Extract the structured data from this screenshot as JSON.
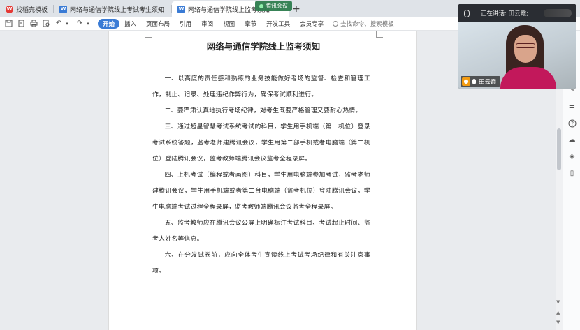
{
  "tabs": [
    {
      "label": "找稻壳模板",
      "icon": "wps-icon",
      "color": "#e53935",
      "active": false
    },
    {
      "label": "网络与通信学院线上考试考生须知",
      "icon": "writer-doc-icon",
      "color": "#3a7bd5",
      "active": false
    },
    {
      "label": "网络与通信学院线上监考须知",
      "icon": "writer-doc-icon",
      "color": "#3a7bd5",
      "active": true
    }
  ],
  "meeting_badge": "腾讯会议",
  "toolbar": {
    "menu": [
      "开始",
      "插入",
      "页面布局",
      "引用",
      "审阅",
      "视图",
      "章节",
      "开发工具",
      "会员专享"
    ],
    "active_menu": "开始",
    "search_placeholder": "查找命令、搜索模板"
  },
  "document": {
    "title": "网络与通信学院线上监考须知",
    "paragraphs": [
      "一、以高度的责任感和熟练的业务技能做好考场的监督、检查和管理工作，制止、记录、处理违纪作弊行为，确保考试顺利进行。",
      "二、要严肃认真地执行考场纪律，对考生既要严格管理又要耐心热情。",
      "三、通过超星智慧考试系统考试的科目，学生用手机端（第一机位）登录考试系统答题，监考老师建腾讯会议，学生用第二部手机或者电脑端（第二机位）登陆腾讯会议，监考教师端腾讯会议监考全程录屏。",
      "四、上机考试（编程或者画图）科目，学生用电脑端参加考试，监考老师建腾讯会议，学生用手机端或者第二台电脑端（监考机位）登陆腾讯会议，学生电脑端考试过程全程录屏，监考教师端腾讯会议监考全程录屏。",
      "五、监考教师应在腾讯会议公屏上明确标注考试科目、考试起止时间、监考人姓名等信息。",
      "六、在分发试卷前，应向全体考生宣读线上考试考场纪律和有关注意事项。"
    ]
  },
  "video": {
    "speaking_label": "正在讲话: 田云霞;",
    "participant_name": "田云霞"
  }
}
